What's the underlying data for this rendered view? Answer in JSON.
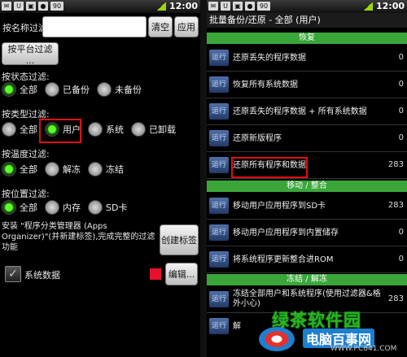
{
  "left": {
    "status": {
      "time": "12:00",
      "icons": [
        "✉",
        "U",
        "▣",
        "●",
        "90"
      ]
    },
    "filter_name_label": "按名称过滤:",
    "clear_button": "清空",
    "apply_button": "应用",
    "platform_button": "按平台过滤 ...",
    "status_filter": {
      "label": "按状态过滤:",
      "options": [
        "全部",
        "已备份",
        "未备份"
      ]
    },
    "type_filter": {
      "label": "按类型过滤:",
      "options": [
        "全部",
        "用户",
        "系统",
        "已卸载"
      ]
    },
    "temp_filter": {
      "label": "按温度过滤:",
      "options": [
        "全部",
        "解冻",
        "冻结"
      ]
    },
    "location_filter": {
      "label": "按位置过滤:",
      "options": [
        "全部",
        "内存",
        "SD卡"
      ]
    },
    "install_text": "安装 \"程序分类管理器 (Apps Organizer)\"(并新建标签),完成完整的过滤功能",
    "create_tag_button": "创建标签",
    "system_data_label": "系统数据",
    "edit_button": "编辑..."
  },
  "right": {
    "status": {
      "time": "12:00",
      "icons": [
        "✉",
        "U",
        "▣",
        "●",
        "90"
      ]
    },
    "title": "批量备份/还原 - 全部 (用户)",
    "run_label": "运行",
    "sections": [
      {
        "name": "恢复",
        "rows": [
          {
            "text": "还原丢失的程序数据",
            "count": "0"
          },
          {
            "text": "恢复所有系统数据",
            "count": "0"
          },
          {
            "text": "还原丢失的程序数据 + 所有系统数据",
            "count": "0"
          },
          {
            "text": "还原新版程序",
            "count": "0"
          },
          {
            "text": "还原所有程序和数据",
            "count": "283"
          }
        ]
      },
      {
        "name": "移动 / 整合",
        "rows": [
          {
            "text": "移动用户应用程序到SD卡",
            "count": "283"
          },
          {
            "text": "移动用户应用程序到内置储存",
            "count": "0"
          },
          {
            "text": "将系统程序更新整合进ROM",
            "count": "0"
          }
        ]
      },
      {
        "name": "冻结 / 解冻",
        "rows": [
          {
            "text": "冻结全部用户和系统程序(使用过滤器&格外小心)",
            "count": "283"
          },
          {
            "text": "解",
            "count": ""
          }
        ]
      }
    ],
    "watermark": {
      "line1": "绿茶软件园",
      "line2": "电脑百事网",
      "line3": "WWW.PC841.COM"
    }
  }
}
